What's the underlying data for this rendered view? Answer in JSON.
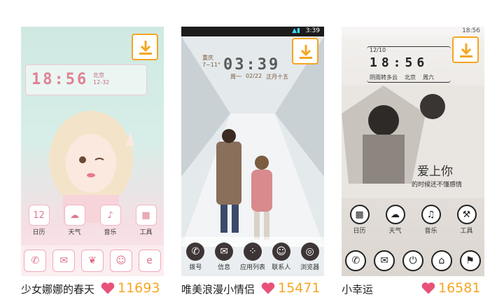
{
  "themes": [
    {
      "name": "少女娜娜的春天",
      "likes": "11693",
      "status_time": "",
      "clock": {
        "time": "18:56",
        "date": "12",
        "weather": "北京",
        "weather_temp": "12-32"
      },
      "apps": [
        "日历",
        "天气",
        "音乐",
        "工具"
      ],
      "dock": [
        "phone-icon",
        "mail-icon",
        "bow-icon",
        "contact-icon",
        "browser-icon"
      ]
    },
    {
      "name": "唯美浪漫小情侣",
      "likes": "15471",
      "status_time": "3:39",
      "clock": {
        "time": "03:39",
        "city": "重庆",
        "temp": "7~11°",
        "weekday": "周一",
        "date": "02/22",
        "lunar": "正月十五"
      },
      "apps": [],
      "dock_labels": [
        "拨号",
        "信息",
        "应用列表",
        "联系人",
        "浏览器"
      ]
    },
    {
      "name": "小幸运",
      "likes": "16581",
      "status_time": "18:56",
      "clock": {
        "time": "18:56",
        "date": "12/10",
        "city": "北京",
        "weekday": "周六",
        "extra": "阴雨转多云"
      },
      "side_title": "爱上你",
      "side_sub": "的时候还不懂感情",
      "apps": [
        "日历",
        "天气",
        "音乐",
        "工具"
      ],
      "dock": [
        "phone-icon",
        "mail-icon",
        "power-icon",
        "home-icon",
        "flag-icon"
      ]
    }
  ],
  "colors": {
    "accent": "#f5a623",
    "heart": "#e8527a"
  }
}
